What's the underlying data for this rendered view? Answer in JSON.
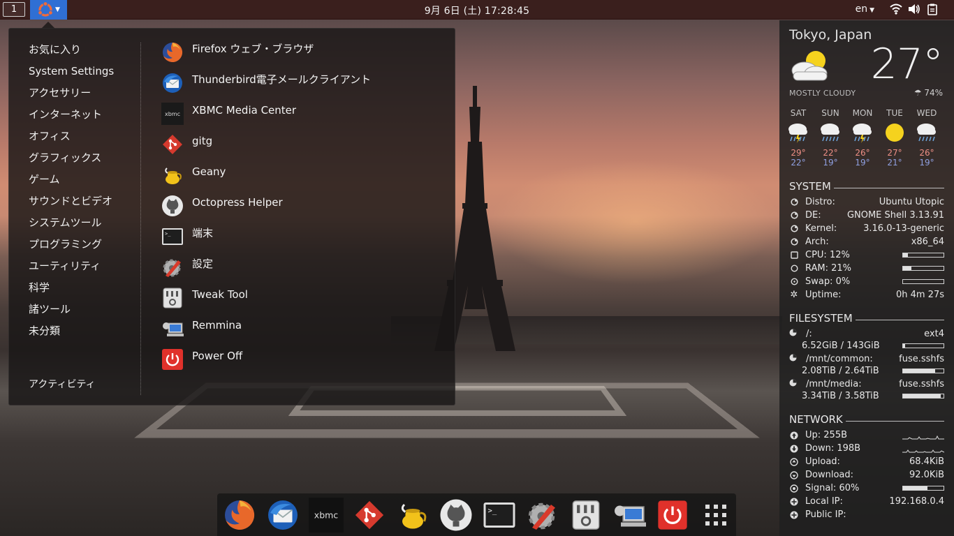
{
  "topbar": {
    "workspace": "1",
    "clock": "9月 6日 (土) 17:28:45",
    "language": "en"
  },
  "app_menu": {
    "categories": [
      "お気に入り",
      "System Settings",
      "アクセサリー",
      "インターネット",
      "オフィス",
      "グラフィックス",
      "ゲーム",
      "サウンドとビデオ",
      "システムツール",
      "プログラミング",
      "ユーティリティ",
      "科学",
      "諸ツール",
      "未分類"
    ],
    "activities": "アクティビティ",
    "apps": [
      {
        "label": "Firefox ウェブ・ブラウザ",
        "icon": "firefox-icon"
      },
      {
        "label": "Thunderbird電子メールクライアント",
        "icon": "thunderbird-icon"
      },
      {
        "label": "XBMC Media Center",
        "icon": "xbmc-icon"
      },
      {
        "label": "gitg",
        "icon": "gitg-icon"
      },
      {
        "label": "Geany",
        "icon": "geany-icon"
      },
      {
        "label": "Octopress Helper",
        "icon": "octocat-icon"
      },
      {
        "label": "端末",
        "icon": "terminal-icon"
      },
      {
        "label": "設定",
        "icon": "settings-icon"
      },
      {
        "label": "Tweak Tool",
        "icon": "tweak-tool-icon"
      },
      {
        "label": "Remmina",
        "icon": "remmina-icon"
      },
      {
        "label": "Power Off",
        "icon": "power-icon"
      }
    ]
  },
  "dock": {
    "items": [
      "firefox-icon",
      "thunderbird-icon",
      "xbmc-icon",
      "gitg-icon",
      "geany-icon",
      "octocat-icon",
      "terminal-icon",
      "settings-icon",
      "tweak-tool-icon",
      "remmina-icon",
      "power-icon",
      "show-apps-grid-icon"
    ],
    "xbmc_logo_text": "xbmc"
  },
  "weather": {
    "city": "Tokyo, Japan",
    "temperature": "27°",
    "condition": "MOSTLY CLOUDY",
    "humidity": "74%",
    "forecast": [
      {
        "day": "SAT",
        "hi": "29°",
        "lo": "22°",
        "icon": "rain-storm-icon"
      },
      {
        "day": "SUN",
        "hi": "22°",
        "lo": "19°",
        "icon": "rain-icon"
      },
      {
        "day": "MON",
        "hi": "26°",
        "lo": "19°",
        "icon": "rain-storm-icon"
      },
      {
        "day": "TUE",
        "hi": "27°",
        "lo": "21°",
        "icon": "sun-icon"
      },
      {
        "day": "WED",
        "hi": "26°",
        "lo": "19°",
        "icon": "rain-icon"
      }
    ]
  },
  "system": {
    "title": "SYSTEM",
    "rows": [
      {
        "label": "Distro:",
        "value": "Ubuntu Utopic"
      },
      {
        "label": "DE:",
        "value": "GNOME Shell 3.13.91"
      },
      {
        "label": "Kernel:",
        "value": "3.16.0-13-generic"
      },
      {
        "label": "Arch:",
        "value": "x86_64"
      }
    ],
    "cpu": {
      "label": "CPU: 12%",
      "percent": 12
    },
    "ram": {
      "label": "RAM: 21%",
      "percent": 21
    },
    "swap": {
      "label": "Swap: 0%",
      "percent": 0
    },
    "uptime": {
      "label": "Uptime:",
      "value": "0h 4m 27s"
    }
  },
  "filesystem": {
    "title": "FILESYSTEM",
    "mounts": [
      {
        "path": "/:",
        "type": "ext4",
        "usage": "6.52GiB / 143GiB",
        "percent": 5
      },
      {
        "path": "/mnt/common:",
        "type": "fuse.sshfs",
        "usage": "2.08TiB / 2.64TiB",
        "percent": 79
      },
      {
        "path": "/mnt/media:",
        "type": "fuse.sshfs",
        "usage": "3.34TiB / 3.58TiB",
        "percent": 93
      }
    ]
  },
  "network": {
    "title": "NETWORK",
    "up": "Up: 255B",
    "down": "Down: 198B",
    "upload": {
      "label": "Upload:",
      "value": "68.4KiB"
    },
    "download": {
      "label": "Download:",
      "value": "92.0KiB"
    },
    "signal": {
      "label": "Signal: 60%",
      "percent": 60
    },
    "local_ip": {
      "label": "Local IP:",
      "value": "192.168.0.4"
    },
    "public_ip": {
      "label": "Public IP:",
      "value": ""
    }
  },
  "colors": {
    "topbar": "#3a1f1d",
    "apps_button": "#2f6fd4",
    "forecast_hi": "#ee8f85",
    "forecast_lo": "#8fa0e0"
  }
}
